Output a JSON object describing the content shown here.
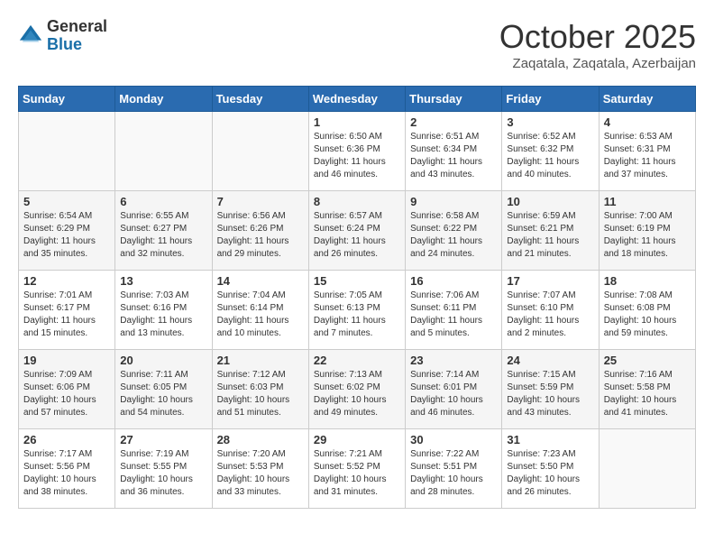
{
  "header": {
    "logo_general": "General",
    "logo_blue": "Blue",
    "month_title": "October 2025",
    "location": "Zaqatala, Zaqatala, Azerbaijan"
  },
  "days_of_week": [
    "Sunday",
    "Monday",
    "Tuesday",
    "Wednesday",
    "Thursday",
    "Friday",
    "Saturday"
  ],
  "weeks": [
    [
      {
        "day": "",
        "info": ""
      },
      {
        "day": "",
        "info": ""
      },
      {
        "day": "",
        "info": ""
      },
      {
        "day": "1",
        "info": "Sunrise: 6:50 AM\nSunset: 6:36 PM\nDaylight: 11 hours\nand 46 minutes."
      },
      {
        "day": "2",
        "info": "Sunrise: 6:51 AM\nSunset: 6:34 PM\nDaylight: 11 hours\nand 43 minutes."
      },
      {
        "day": "3",
        "info": "Sunrise: 6:52 AM\nSunset: 6:32 PM\nDaylight: 11 hours\nand 40 minutes."
      },
      {
        "day": "4",
        "info": "Sunrise: 6:53 AM\nSunset: 6:31 PM\nDaylight: 11 hours\nand 37 minutes."
      }
    ],
    [
      {
        "day": "5",
        "info": "Sunrise: 6:54 AM\nSunset: 6:29 PM\nDaylight: 11 hours\nand 35 minutes."
      },
      {
        "day": "6",
        "info": "Sunrise: 6:55 AM\nSunset: 6:27 PM\nDaylight: 11 hours\nand 32 minutes."
      },
      {
        "day": "7",
        "info": "Sunrise: 6:56 AM\nSunset: 6:26 PM\nDaylight: 11 hours\nand 29 minutes."
      },
      {
        "day": "8",
        "info": "Sunrise: 6:57 AM\nSunset: 6:24 PM\nDaylight: 11 hours\nand 26 minutes."
      },
      {
        "day": "9",
        "info": "Sunrise: 6:58 AM\nSunset: 6:22 PM\nDaylight: 11 hours\nand 24 minutes."
      },
      {
        "day": "10",
        "info": "Sunrise: 6:59 AM\nSunset: 6:21 PM\nDaylight: 11 hours\nand 21 minutes."
      },
      {
        "day": "11",
        "info": "Sunrise: 7:00 AM\nSunset: 6:19 PM\nDaylight: 11 hours\nand 18 minutes."
      }
    ],
    [
      {
        "day": "12",
        "info": "Sunrise: 7:01 AM\nSunset: 6:17 PM\nDaylight: 11 hours\nand 15 minutes."
      },
      {
        "day": "13",
        "info": "Sunrise: 7:03 AM\nSunset: 6:16 PM\nDaylight: 11 hours\nand 13 minutes."
      },
      {
        "day": "14",
        "info": "Sunrise: 7:04 AM\nSunset: 6:14 PM\nDaylight: 11 hours\nand 10 minutes."
      },
      {
        "day": "15",
        "info": "Sunrise: 7:05 AM\nSunset: 6:13 PM\nDaylight: 11 hours\nand 7 minutes."
      },
      {
        "day": "16",
        "info": "Sunrise: 7:06 AM\nSunset: 6:11 PM\nDaylight: 11 hours\nand 5 minutes."
      },
      {
        "day": "17",
        "info": "Sunrise: 7:07 AM\nSunset: 6:10 PM\nDaylight: 11 hours\nand 2 minutes."
      },
      {
        "day": "18",
        "info": "Sunrise: 7:08 AM\nSunset: 6:08 PM\nDaylight: 10 hours\nand 59 minutes."
      }
    ],
    [
      {
        "day": "19",
        "info": "Sunrise: 7:09 AM\nSunset: 6:06 PM\nDaylight: 10 hours\nand 57 minutes."
      },
      {
        "day": "20",
        "info": "Sunrise: 7:11 AM\nSunset: 6:05 PM\nDaylight: 10 hours\nand 54 minutes."
      },
      {
        "day": "21",
        "info": "Sunrise: 7:12 AM\nSunset: 6:03 PM\nDaylight: 10 hours\nand 51 minutes."
      },
      {
        "day": "22",
        "info": "Sunrise: 7:13 AM\nSunset: 6:02 PM\nDaylight: 10 hours\nand 49 minutes."
      },
      {
        "day": "23",
        "info": "Sunrise: 7:14 AM\nSunset: 6:01 PM\nDaylight: 10 hours\nand 46 minutes."
      },
      {
        "day": "24",
        "info": "Sunrise: 7:15 AM\nSunset: 5:59 PM\nDaylight: 10 hours\nand 43 minutes."
      },
      {
        "day": "25",
        "info": "Sunrise: 7:16 AM\nSunset: 5:58 PM\nDaylight: 10 hours\nand 41 minutes."
      }
    ],
    [
      {
        "day": "26",
        "info": "Sunrise: 7:17 AM\nSunset: 5:56 PM\nDaylight: 10 hours\nand 38 minutes."
      },
      {
        "day": "27",
        "info": "Sunrise: 7:19 AM\nSunset: 5:55 PM\nDaylight: 10 hours\nand 36 minutes."
      },
      {
        "day": "28",
        "info": "Sunrise: 7:20 AM\nSunset: 5:53 PM\nDaylight: 10 hours\nand 33 minutes."
      },
      {
        "day": "29",
        "info": "Sunrise: 7:21 AM\nSunset: 5:52 PM\nDaylight: 10 hours\nand 31 minutes."
      },
      {
        "day": "30",
        "info": "Sunrise: 7:22 AM\nSunset: 5:51 PM\nDaylight: 10 hours\nand 28 minutes."
      },
      {
        "day": "31",
        "info": "Sunrise: 7:23 AM\nSunset: 5:50 PM\nDaylight: 10 hours\nand 26 minutes."
      },
      {
        "day": "",
        "info": ""
      }
    ]
  ]
}
